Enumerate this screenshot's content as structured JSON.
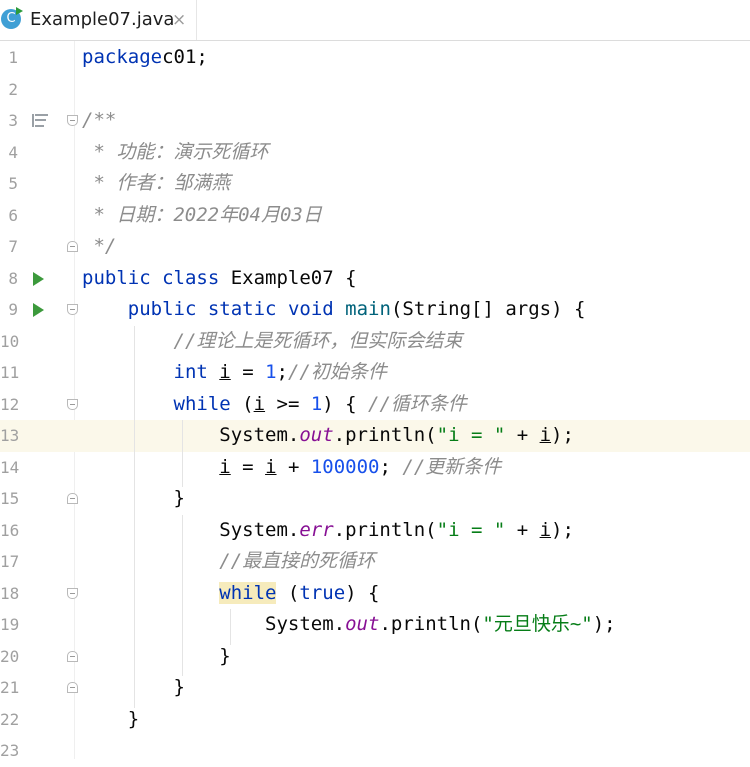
{
  "tab": {
    "icon_letter": "C",
    "title": "Example07.java",
    "close": "×"
  },
  "editor": {
    "current_line": 13,
    "lines": [
      {
        "n": "1",
        "tokens": [
          [
            "kw",
            "package"
          ],
          [
            "",
            "c01;"
          ]
        ]
      },
      {
        "n": "2",
        "tokens": []
      },
      {
        "n": "3",
        "tokens": [
          [
            "doc",
            "/**"
          ]
        ]
      },
      {
        "n": "4",
        "tokens": [
          [
            "doc",
            " * 功能：演示死循环"
          ]
        ]
      },
      {
        "n": "5",
        "tokens": [
          [
            "doc",
            " * 作者：邹满燕"
          ]
        ]
      },
      {
        "n": "6",
        "tokens": [
          [
            "doc",
            " * 日期：2022年04月03日"
          ]
        ]
      },
      {
        "n": "7",
        "tokens": [
          [
            "doc",
            " */"
          ]
        ]
      },
      {
        "n": "8",
        "tokens": [
          [
            "kw",
            "public"
          ],
          [
            "",
            " "
          ],
          [
            "kw",
            "class"
          ],
          [
            "",
            " Example07 {"
          ]
        ]
      },
      {
        "n": "9",
        "tokens": [
          [
            "",
            "    "
          ],
          [
            "kw",
            "public"
          ],
          [
            "",
            " "
          ],
          [
            "kw",
            "static"
          ],
          [
            "",
            " "
          ],
          [
            "kw",
            "void"
          ],
          [
            "",
            " "
          ],
          [
            "mth",
            "main"
          ],
          [
            "",
            "(String[] args) {"
          ]
        ]
      },
      {
        "n": "10",
        "tokens": [
          [
            "",
            "        "
          ],
          [
            "cmt",
            "//理论上是死循环，但实际会结束"
          ]
        ]
      },
      {
        "n": "11",
        "tokens": [
          [
            "",
            "        "
          ],
          [
            "kw",
            "int"
          ],
          [
            "",
            " "
          ],
          [
            "ul",
            "i"
          ],
          [
            "",
            " = "
          ],
          [
            "num",
            "1"
          ],
          [
            "",
            ";"
          ],
          [
            "cmt",
            "//初始条件"
          ]
        ]
      },
      {
        "n": "12",
        "tokens": [
          [
            "",
            "        "
          ],
          [
            "kw",
            "while"
          ],
          [
            "",
            " ("
          ],
          [
            "ul",
            "i"
          ],
          [
            "",
            " >= "
          ],
          [
            "num",
            "1"
          ],
          [
            "",
            ") { "
          ],
          [
            "cmt",
            "//循环条件"
          ]
        ]
      },
      {
        "n": "13",
        "tokens": [
          [
            "",
            "            System."
          ],
          [
            "fld",
            "out"
          ],
          [
            "",
            ".println("
          ],
          [
            "str",
            "\"i = \""
          ],
          [
            "",
            " + "
          ],
          [
            "ul",
            "i"
          ],
          [
            "",
            ");"
          ]
        ]
      },
      {
        "n": "14",
        "tokens": [
          [
            "",
            "            "
          ],
          [
            "ul",
            "i"
          ],
          [
            "",
            " = "
          ],
          [
            "ul",
            "i"
          ],
          [
            "",
            " + "
          ],
          [
            "num",
            "100000"
          ],
          [
            "",
            "; "
          ],
          [
            "cmt",
            "//更新条件"
          ]
        ]
      },
      {
        "n": "15",
        "tokens": [
          [
            "",
            "        }"
          ]
        ]
      },
      {
        "n": "16",
        "tokens": [
          [
            "",
            "            System."
          ],
          [
            "fld",
            "err"
          ],
          [
            "",
            ".println("
          ],
          [
            "str",
            "\"i = \""
          ],
          [
            "",
            " + "
          ],
          [
            "ul",
            "i"
          ],
          [
            "",
            ");"
          ]
        ]
      },
      {
        "n": "17",
        "tokens": [
          [
            "",
            "            "
          ],
          [
            "cmt",
            "//最直接的死循环"
          ]
        ]
      },
      {
        "n": "18",
        "tokens": [
          [
            "",
            "            "
          ],
          [
            "kwhl",
            "while"
          ],
          [
            "",
            " ("
          ],
          [
            "kw",
            "true"
          ],
          [
            "",
            ") {"
          ]
        ]
      },
      {
        "n": "19",
        "tokens": [
          [
            "",
            "                System."
          ],
          [
            "fld",
            "out"
          ],
          [
            "",
            ".println("
          ],
          [
            "str",
            "\"元旦快乐~\""
          ],
          [
            "",
            ");"
          ]
        ]
      },
      {
        "n": "20",
        "tokens": [
          [
            "",
            "            }"
          ]
        ]
      },
      {
        "n": "21",
        "tokens": [
          [
            "",
            "        }"
          ]
        ]
      },
      {
        "n": "22",
        "tokens": [
          [
            "",
            "    }"
          ]
        ]
      },
      {
        "n": "23",
        "tokens": []
      }
    ]
  },
  "gutter_markers": {
    "doc_lines": [
      "3"
    ],
    "run_lines": [
      "8",
      "9"
    ],
    "fold_open_lines": [
      "3",
      "9",
      "12",
      "18"
    ],
    "fold_close_lines": [
      "7",
      "15",
      "20",
      "21"
    ]
  },
  "colors": {
    "keyword": "#0033b3",
    "number": "#1750eb",
    "string": "#067d17",
    "field": "#871094",
    "method": "#00627a",
    "comment": "#8c8c8c",
    "current_line": "#fbf8ea"
  }
}
